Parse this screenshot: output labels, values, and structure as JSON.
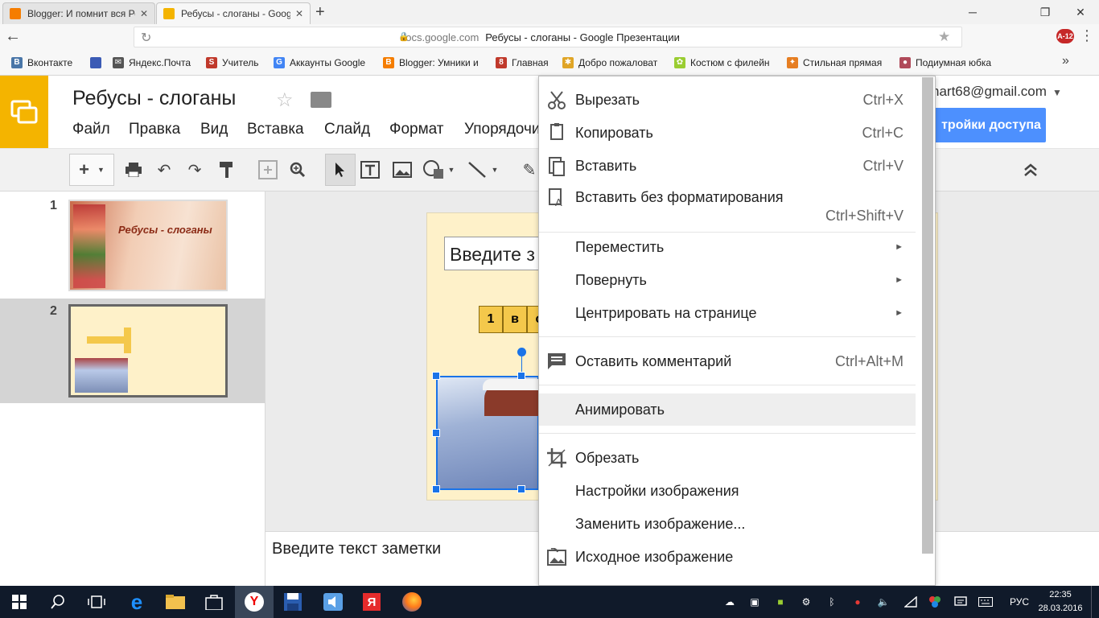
{
  "browser": {
    "tabs": [
      {
        "title": "Blogger: И помнит вся Росси",
        "active": false,
        "favicon_color": "#f57d00"
      },
      {
        "title": "Ребусы - слоганы - Goog",
        "active": true,
        "favicon_color": "#f4b400"
      }
    ],
    "new_tab_icon": "+",
    "window_buttons": [
      "minimize-icon",
      "maximize-icon",
      "close-icon"
    ],
    "url_host": "docs.google.com",
    "url_page": "Ребусы - слоганы - Google Презентации",
    "back_icon": "←",
    "reload_icon": "↻",
    "star_icon": "★",
    "badge_text": "A-12"
  },
  "bookmarks": [
    {
      "label": "Вконтакте",
      "icon": "vk-icon",
      "color": "#4a76a8",
      "glyph": "B"
    },
    {
      "label": "",
      "icon": "globe-icon",
      "color": "#3b5bb5",
      "glyph": ""
    },
    {
      "label": "Яндекс.Почта",
      "icon": "mail-icon",
      "color": "#555555",
      "glyph": "✉"
    },
    {
      "label": "Учитель",
      "icon": "s-icon",
      "color": "#c0392b",
      "glyph": "S"
    },
    {
      "label": "Аккаунты Google",
      "icon": "google-icon",
      "color": "#4285f4",
      "glyph": "G"
    },
    {
      "label": "Blogger: Умники и",
      "icon": "blogger-icon",
      "color": "#f57d00",
      "glyph": "B"
    },
    {
      "label": "Главная",
      "icon": "home-icon",
      "color": "#c0392b",
      "glyph": "8"
    },
    {
      "label": "Добро пожаловат",
      "icon": "welcome-icon",
      "color": "#e0a526",
      "glyph": "✱"
    },
    {
      "label": "Костюм с филейн",
      "icon": "lace-icon",
      "color": "#9acd32",
      "glyph": "✿"
    },
    {
      "label": "Стильная прямая",
      "icon": "skirt-icon",
      "color": "#e67e22",
      "glyph": "✦"
    },
    {
      "label": "Подиумная юбка",
      "icon": "podium-icon",
      "color": "#b04a5a",
      "glyph": "●"
    }
  ],
  "bookmarks_more": "»",
  "slides": {
    "title": "Ребусы - слоганы",
    "menus": [
      "Файл",
      "Правка",
      "Вид",
      "Вставка",
      "Слайд",
      "Формат",
      "Упорядочи"
    ],
    "email": "nart68@gmail.com",
    "share_label": "тройки доступа",
    "collapse_icon": "⌃",
    "filmstrip": [
      {
        "number": "1",
        "thumb_title": "Ребусы - слоганы"
      },
      {
        "number": "2",
        "thumb_title": ""
      }
    ],
    "slide": {
      "title_placeholder": "Введите з",
      "cells": [
        "1",
        "в",
        "с"
      ]
    },
    "notes_placeholder": "Введите текст заметки"
  },
  "context_menu": {
    "items": [
      {
        "label": "Вырезать",
        "shortcut": "Ctrl+X",
        "icon": "scissors-icon"
      },
      {
        "label": "Копировать",
        "shortcut": "Ctrl+C",
        "icon": "copy-icon"
      },
      {
        "label": "Вставить",
        "shortcut": "Ctrl+V",
        "icon": "paste-icon"
      },
      {
        "label": "Вставить без форматирования",
        "shortcut": "Ctrl+Shift+V",
        "icon": "paste-plain-icon"
      },
      {
        "label": "Переместить",
        "shortcut": "",
        "icon": ""
      },
      {
        "label": "Повернуть",
        "shortcut": "",
        "icon": ""
      },
      {
        "label": "Центрировать на странице",
        "shortcut": "",
        "icon": ""
      },
      {
        "label": "Оставить комментарий",
        "shortcut": "Ctrl+Alt+M",
        "icon": "comment-icon"
      },
      {
        "label": "Анимировать",
        "shortcut": "",
        "icon": ""
      },
      {
        "label": "Обрезать",
        "shortcut": "",
        "icon": "crop-icon"
      },
      {
        "label": "Настройки изображения",
        "shortcut": "",
        "icon": ""
      },
      {
        "label": "Заменить изображение...",
        "shortcut": "",
        "icon": ""
      },
      {
        "label": "Исходное изображение",
        "shortcut": "",
        "icon": "reset-image-icon"
      }
    ],
    "submenu_arrow": "►"
  },
  "taskbar": {
    "language": "РУС",
    "time": "22:35",
    "date": "28.03.2016"
  },
  "colors": {
    "slides_brand": "#f4b400",
    "share_blue": "#4d90fe",
    "selection_blue": "#1a73e8",
    "slide_bg": "#fef1c9",
    "menu_highlight": "#eeeeee",
    "taskbar_bg": "#101a2a"
  }
}
